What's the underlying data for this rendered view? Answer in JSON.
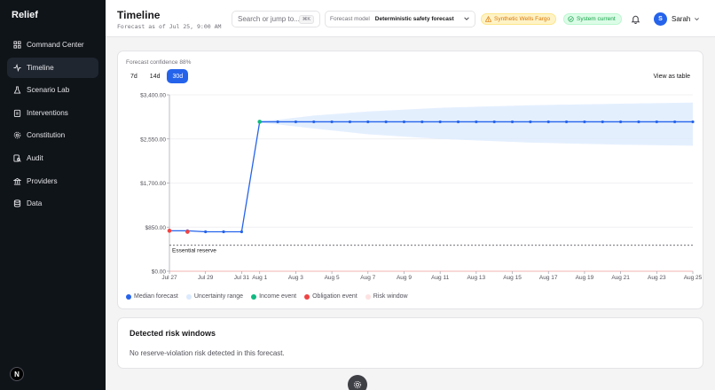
{
  "app": {
    "brand": "Relief",
    "badge_letter": "N"
  },
  "sidebar": {
    "items": [
      {
        "label": "Command Center",
        "icon": "grid-icon"
      },
      {
        "label": "Timeline",
        "icon": "activity-icon",
        "active": true
      },
      {
        "label": "Scenario Lab",
        "icon": "flask-icon"
      },
      {
        "label": "Interventions",
        "icon": "clipboard-icon"
      },
      {
        "label": "Constitution",
        "icon": "settings-icon"
      },
      {
        "label": "Audit",
        "icon": "audit-icon"
      },
      {
        "label": "Providers",
        "icon": "bank-icon"
      },
      {
        "label": "Data",
        "icon": "database-icon"
      }
    ]
  },
  "header": {
    "title": "Timeline",
    "subtitle": "Forecast as of Jul 25, 9:00 AM",
    "search_placeholder": "Search or jump to...",
    "search_shortcut": "⌘K",
    "model_label": "Forecast model",
    "model_value": "Deterministic safety forecast",
    "warn_badge": "Synthetic Wells Fargo",
    "ok_badge": "System current",
    "user_initial": "S",
    "user_name": "Sarah"
  },
  "chart_card": {
    "confidence": "Forecast confidence 88%",
    "ranges": [
      "7d",
      "14d",
      "30d"
    ],
    "active_range": "30d",
    "view_table": "View as table",
    "legend": [
      {
        "label": "Median forecast",
        "color": "#2563eb"
      },
      {
        "label": "Uncertainty range",
        "color": "#dbeafe"
      },
      {
        "label": "Income event",
        "color": "#10b981"
      },
      {
        "label": "Obligation event",
        "color": "#ef4444"
      },
      {
        "label": "Risk window",
        "color": "#fee2e2"
      }
    ]
  },
  "chart_data": {
    "type": "line",
    "title": "",
    "xlabel": "",
    "ylabel": "",
    "ylim": [
      0,
      3400
    ],
    "yticks": [
      0,
      850,
      1700,
      2550,
      3400
    ],
    "ytick_labels": [
      "$0.00",
      "$850.00",
      "$1,700.00",
      "$2,550.00",
      "$3,400.00"
    ],
    "x_start": "Jul 27",
    "xtick_labels": [
      "Jul 27",
      "Jul 29",
      "Jul 31",
      "Aug 1",
      "Aug 3",
      "Aug 5",
      "Aug 7",
      "Aug 9",
      "Aug 11",
      "Aug 13",
      "Aug 15",
      "Aug 17",
      "Aug 19",
      "Aug 21",
      "Aug 23",
      "Aug 25"
    ],
    "xtick_days": [
      0,
      2,
      4,
      5,
      7,
      9,
      11,
      13,
      15,
      17,
      19,
      21,
      23,
      25,
      27,
      29
    ],
    "series": [
      {
        "name": "Median forecast",
        "days": [
          0,
          1,
          2,
          3,
          4,
          5,
          6,
          7,
          8,
          9,
          10,
          11,
          12,
          13,
          14,
          15,
          16,
          17,
          18,
          19,
          20,
          21,
          22,
          23,
          24,
          25,
          26,
          27,
          28,
          29
        ],
        "values": [
          780,
          780,
          760,
          760,
          760,
          2880,
          2880,
          2880,
          2880,
          2880,
          2880,
          2880,
          2880,
          2880,
          2880,
          2880,
          2880,
          2880,
          2880,
          2880,
          2880,
          2880,
          2880,
          2880,
          2880,
          2880,
          2880,
          2880,
          2880,
          2880
        ]
      }
    ],
    "uncertainty": {
      "days": [
        5,
        6,
        8,
        11,
        15,
        20,
        25,
        29
      ],
      "upper": [
        2900,
        2920,
        3000,
        3080,
        3150,
        3200,
        3230,
        3250
      ],
      "lower": [
        2860,
        2830,
        2750,
        2640,
        2550,
        2480,
        2440,
        2420
      ]
    },
    "income_events": [
      {
        "day": 5,
        "value": 2880
      }
    ],
    "obligation_events": [
      {
        "day": 0,
        "value": 780
      },
      {
        "day": 1,
        "value": 760
      }
    ],
    "reserve": {
      "label": "Essential reserve",
      "value": 500
    }
  },
  "risk_card": {
    "title": "Detected risk windows",
    "empty_text": "No reserve-violation risk detected in this forecast."
  }
}
